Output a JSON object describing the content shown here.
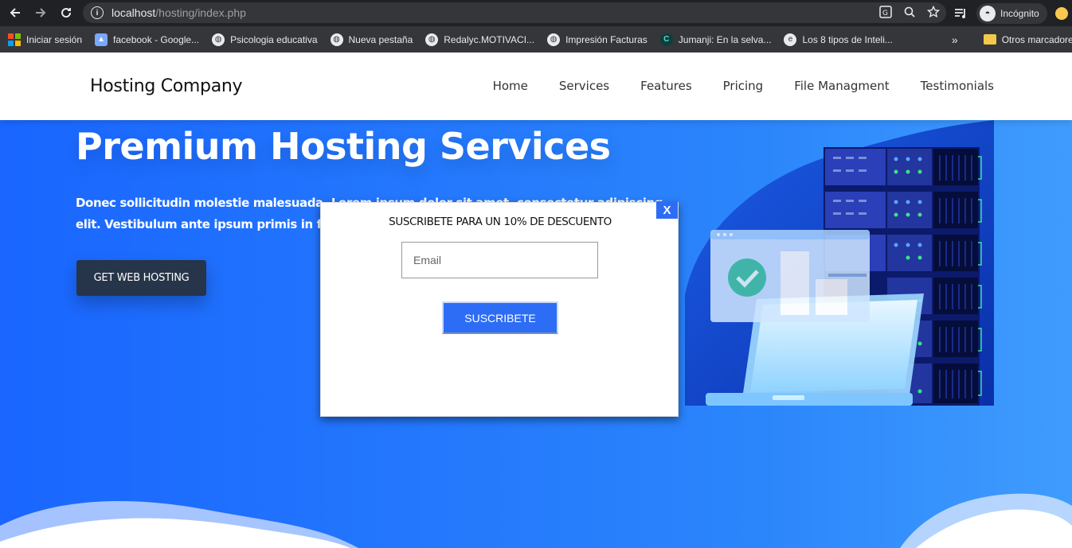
{
  "browser": {
    "url_host": "localhost",
    "url_path": "/hosting/index.php",
    "incognito_label": "Incógnito"
  },
  "bookmarks": [
    {
      "label": "Iniciar sesión",
      "icon": "microsoft-icon"
    },
    {
      "label": "facebook - Google...",
      "icon": "graduation-cap-icon"
    },
    {
      "label": "Psicologia educativa",
      "icon": "globe-icon"
    },
    {
      "label": "Nueva pestaña",
      "icon": "globe-icon"
    },
    {
      "label": "Redalyc.MOTIVACI...",
      "icon": "globe-icon"
    },
    {
      "label": "Impresión Facturas",
      "icon": "globe-icon"
    },
    {
      "label": "Jumanji: En la selva...",
      "icon": "c-logo-icon"
    },
    {
      "label": "Los 8 tipos de Inteli...",
      "icon": "circle-e-icon"
    }
  ],
  "bookmarks_more": "»",
  "bookmarks_other": "Otros marcadores",
  "site": {
    "brand": "Hosting Company",
    "nav": [
      "Home",
      "Services",
      "Features",
      "Pricing",
      "File Managment",
      "Testimonials"
    ]
  },
  "hero": {
    "title": "Premium Hosting Services",
    "text": "Donec sollicitudin molestie malesuada. Lorem ipsum dolor sit amet, consectetur adipiscing elit. Vestibulum ante ipsum primis in faucibus orci luctus et ultrices posuere cubilia Curae.",
    "button": "GET WEB HOSTING"
  },
  "modal": {
    "close": "X",
    "title": "SUSCRIBETE PARA UN 10% DE DESCUENTO",
    "email_placeholder": "Email",
    "submit": "SUSCRIBETE"
  },
  "colors": {
    "accent": "#2d6df6",
    "hero_gradient_start": "#1a66ff",
    "hero_gradient_end": "#3f9cfd",
    "dark_button": "#263549"
  }
}
